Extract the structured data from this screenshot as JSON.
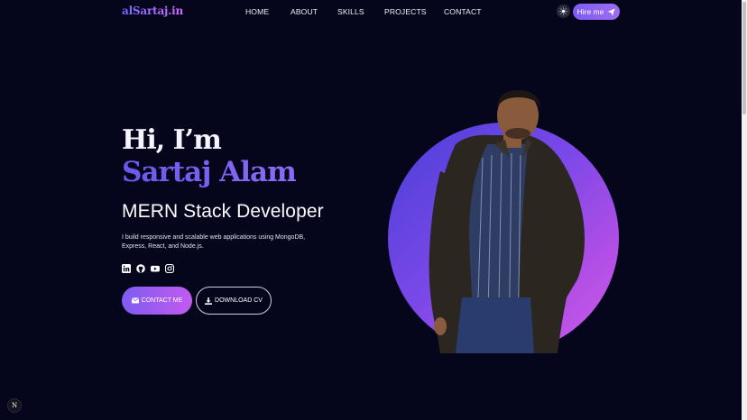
{
  "nav": {
    "logo": "alSartaj.in",
    "items": [
      "HOME",
      "ABOUT",
      "SKILLS",
      "PROJECTS",
      "CONTACT"
    ],
    "hire_label": "Hire me"
  },
  "hero": {
    "greeting": "Hi, I’m",
    "name": "Sartaj Alam",
    "role": "MERN Stack Developer",
    "description": "I build responsive and scalable web applications using MongoDB, Express, React, and Node.js.",
    "socials": [
      "linkedin-icon",
      "github-icon",
      "youtube-icon",
      "instagram-icon"
    ],
    "contact_label": "CONTACT ME",
    "cv_label": "DOWNLOAD CV"
  },
  "badge": {
    "letter": "N"
  },
  "colors": {
    "background": "#05051c",
    "accent": "#7a5cf5",
    "accent2": "#c25af0"
  }
}
